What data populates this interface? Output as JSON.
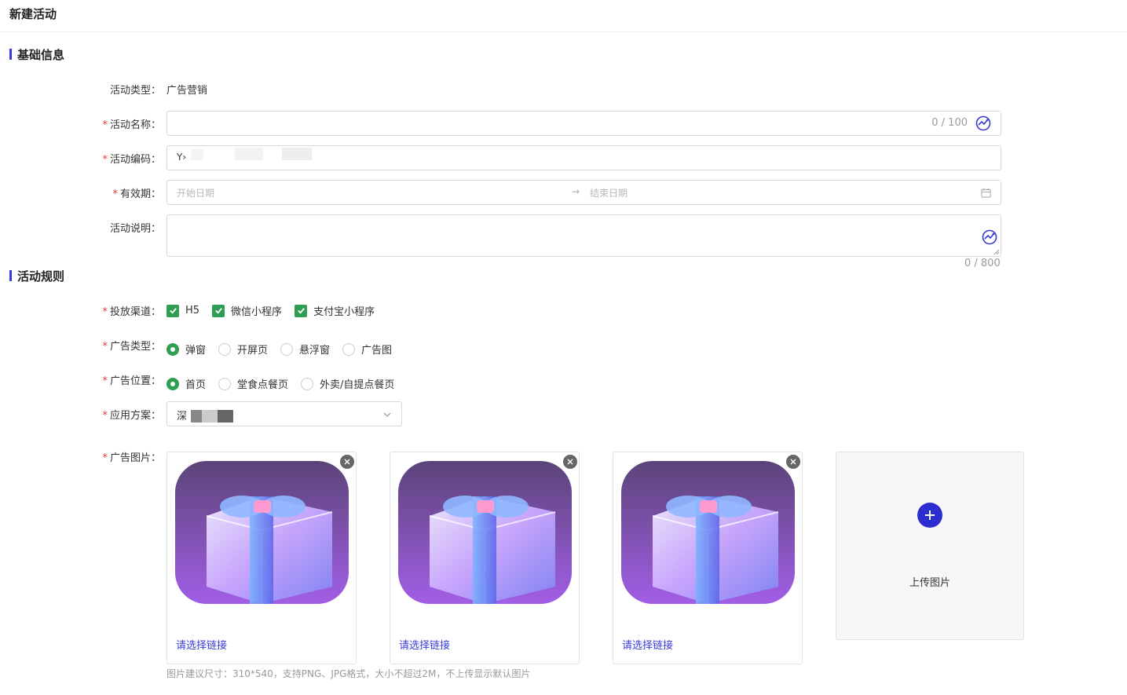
{
  "page": {
    "title": "新建活动"
  },
  "sections": {
    "basic": "基础信息",
    "rules": "活动规则"
  },
  "fields": {
    "type": {
      "label": "活动类型：",
      "value": "广告营销"
    },
    "name": {
      "label": "活动名称：",
      "counter": "0 / 100",
      "value": ""
    },
    "code": {
      "label": "活动编码：",
      "value": "Y›"
    },
    "period": {
      "label": "有效期：",
      "start_placeholder": "开始日期",
      "end_placeholder": "结束日期",
      "arrow": "→"
    },
    "desc": {
      "label": "活动说明：",
      "counter": "0 / 800"
    },
    "channel": {
      "label": "投放渠道：",
      "options": [
        "H5",
        "微信小程序",
        "支付宝小程序"
      ]
    },
    "ad_type": {
      "label": "广告类型：",
      "options": [
        "弹窗",
        "开屏页",
        "悬浮窗",
        "广告图"
      ],
      "selected": "弹窗"
    },
    "ad_position": {
      "label": "广告位置：",
      "options": [
        "首页",
        "堂食点餐页",
        "外卖/自提点餐页"
      ],
      "selected": "首页"
    },
    "plan": {
      "label": "应用方案：",
      "value": "深"
    },
    "images": {
      "label": "广告图片：",
      "cards": [
        {
          "link_label": "请选择链接"
        },
        {
          "link_label": "请选择链接"
        },
        {
          "link_label": "请选择链接"
        }
      ],
      "upload_label": "上传图片",
      "hint": "图片建议尺寸：310*540，支持PNG、JPG格式，大小不超过2M，不上传显示默认图片"
    }
  },
  "required_mark": "*",
  "colors": {
    "accent": "#3a3ad6",
    "check": "#2e9e52",
    "required": "#e53935"
  }
}
